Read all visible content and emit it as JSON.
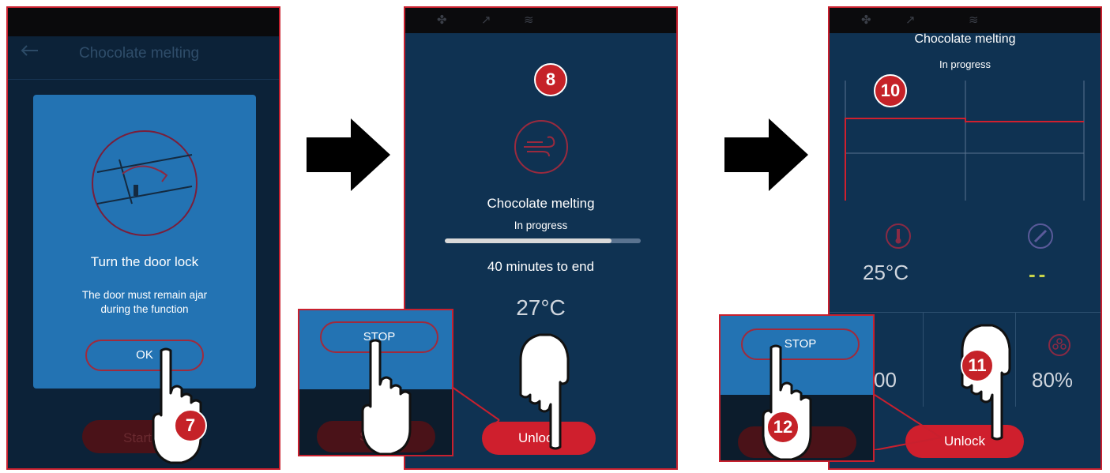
{
  "panel1": {
    "header_title": "Chocolate melting",
    "dialog": {
      "title": "Turn the door lock",
      "message_line1": "The door must remain ajar",
      "message_line2": "during the function",
      "ok_label": "OK"
    },
    "bottom_button_label": "Start",
    "step_badge": "7"
  },
  "panel2": {
    "step_badge": "8",
    "program_name": "Chocolate melting",
    "status": "In progress",
    "progress": 0.85,
    "time_remaining": "40 minutes to end",
    "temperature": "27°C",
    "unlock_label": "Unlock",
    "inset_stop_label": "STOP",
    "inset_button_label": "S"
  },
  "panel3": {
    "program_name": "Chocolate melting",
    "status": "In progress",
    "graph_badge": "10",
    "temperature": "25°C",
    "probe_value": "--",
    "time_value": "00",
    "fan_value": "80%",
    "unlock_label": "Unlock",
    "inset_stop_label": "STOP",
    "step_badge_unlock": "11",
    "step_badge_stop": "12"
  },
  "colors": {
    "accent": "#c8202e",
    "panel_bg": "#0f3252",
    "dialog_bg": "#2073b0",
    "probe_dash": "#c8d44a"
  },
  "icons": {
    "fan": "fan-icon",
    "steam": "steam-icon",
    "heat": "heat-icon",
    "thermometer": "thermometer-icon",
    "probe": "probe-icon",
    "door": "door-lock-icon",
    "wind": "wind-icon",
    "hand": "pointing-hand-icon",
    "arrow": "right-arrow-icon",
    "back": "back-arrow-icon"
  }
}
